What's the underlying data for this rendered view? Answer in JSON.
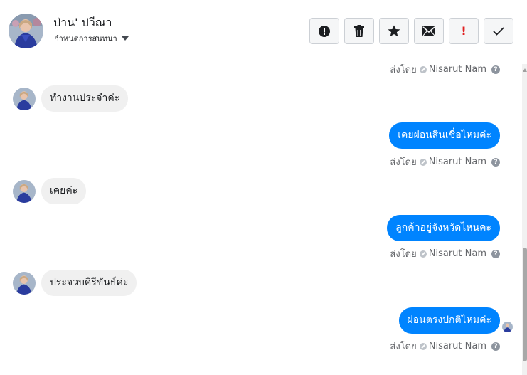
{
  "contact": {
    "name": "ป่าน' ปวีณา",
    "label_select": "กำหนดการสนทนา"
  },
  "toolbar": {
    "buttons": [
      {
        "name": "alert-circle-icon",
        "label": ""
      },
      {
        "name": "trash-icon",
        "label": ""
      },
      {
        "name": "star-icon",
        "label": ""
      },
      {
        "name": "envelope-icon",
        "label": ""
      },
      {
        "name": "exclamation-icon",
        "label": "!"
      },
      {
        "name": "checkmark-icon",
        "label": ""
      }
    ]
  },
  "colors": {
    "outgoing_bubble": "#0084ff",
    "incoming_bubble": "#f0f0f0",
    "urgent": "#e02020"
  },
  "messages": [
    {
      "direction": "in",
      "text": "ทำงานประจำค่ะ"
    },
    {
      "direction": "out",
      "text": "เคยผ่อนสินเชื่อไหมค่ะ",
      "sent_by_label": "ส่งโดย",
      "sent_by": "Nisarut Nam"
    },
    {
      "direction": "in",
      "text": "เคยค่ะ"
    },
    {
      "direction": "out",
      "text": "ลูกค้าอยู่จังหวัดไหนคะ",
      "sent_by_label": "ส่งโดย",
      "sent_by": "Nisarut Nam"
    },
    {
      "direction": "in",
      "text": "ประจวบคีรีขันธ์ค่ะ"
    },
    {
      "direction": "out",
      "text": "ผ่อนตรงปกติไหมค่ะ",
      "sent_by_label": "ส่งโดย",
      "sent_by": "Nisarut Nam"
    }
  ],
  "top_sent_by": {
    "label": "ส่งโดย",
    "name": "Nisarut Nam"
  }
}
